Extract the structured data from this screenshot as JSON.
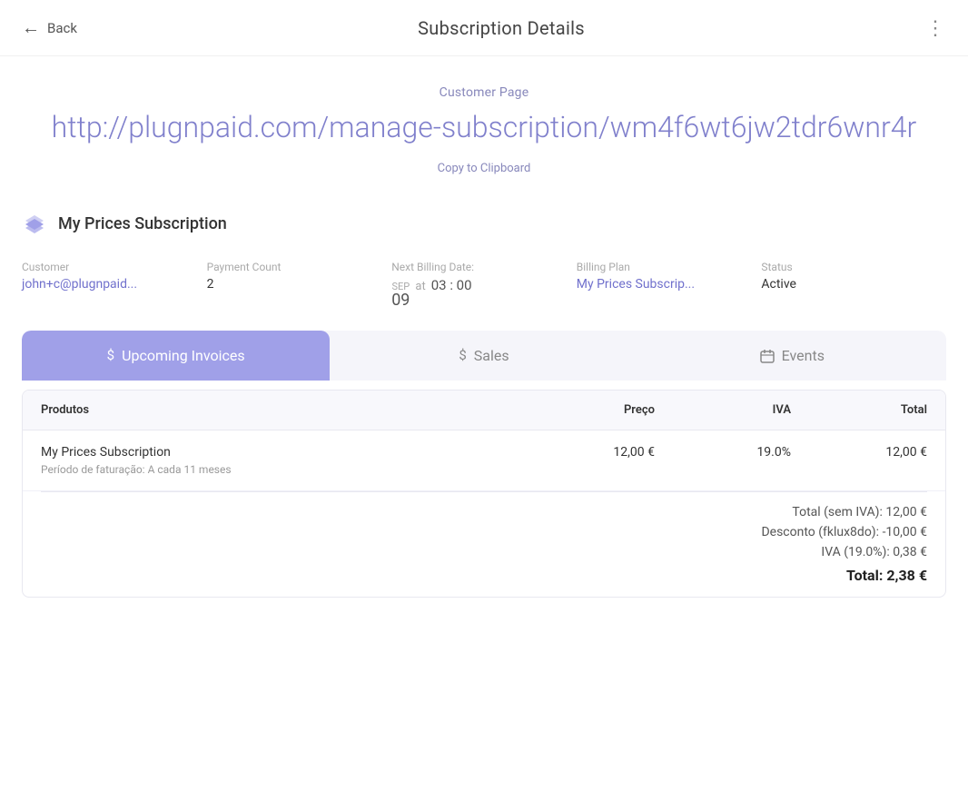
{
  "header": {
    "back_label": "Back",
    "title": "Subscription Details",
    "more_icon": "⋮"
  },
  "customer_page": {
    "label": "Customer Page",
    "url": "http://plugnpaid.com/manage-subscription/wm4f6wt6jw2tdr6wnr4r",
    "copy_label": "Copy to Clipboard"
  },
  "subscription": {
    "name": "My Prices Subscription",
    "customer_label": "Customer",
    "customer_value": "john+c@plugnpaid...",
    "payment_count_label": "Payment Count",
    "payment_count_value": "2",
    "next_billing_label": "Next Billing Date:",
    "billing_month": "SEP",
    "billing_day": "09",
    "billing_at": "at",
    "billing_time": "03 : 00",
    "billing_plan_label": "Billing Plan",
    "billing_plan_value": "My Prices Subscrip...",
    "status_label": "Status",
    "status_value": "Active"
  },
  "tabs": [
    {
      "id": "upcoming",
      "icon": "$",
      "label": "Upcoming Invoices",
      "active": true
    },
    {
      "id": "sales",
      "icon": "$",
      "label": "Sales",
      "active": false
    },
    {
      "id": "events",
      "icon": "📅",
      "label": "Events",
      "active": false
    }
  ],
  "table": {
    "headers": [
      "Produtos",
      "Preço",
      "IVA",
      "Total"
    ],
    "rows": [
      {
        "name": "My Prices Subscription",
        "period": "Período de faturação: A cada 11 meses",
        "preco": "12,00 €",
        "iva": "19.0%",
        "total": "12,00 €"
      }
    ],
    "totals": {
      "sem_iva_label": "Total (sem IVA):",
      "sem_iva_value": "12,00 €",
      "desconto_label": "Desconto (fklux8do):",
      "desconto_value": "-10,00 €",
      "iva_label": "IVA (19.0%):",
      "iva_value": "0,38 €",
      "total_label": "Total:",
      "total_value": "2,38 €"
    }
  }
}
